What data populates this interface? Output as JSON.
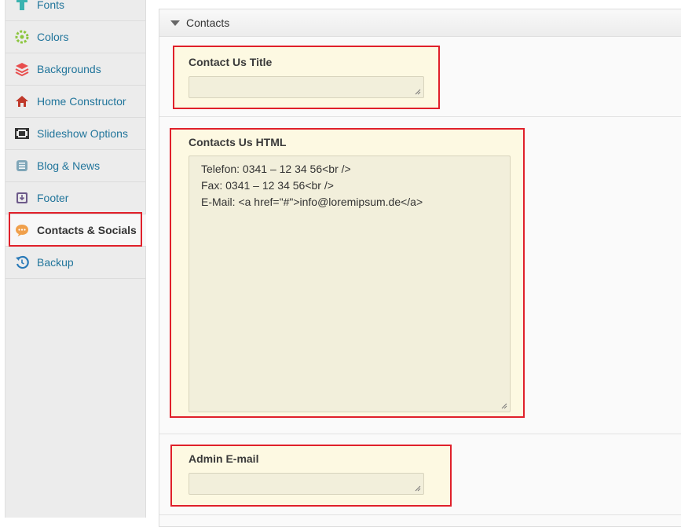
{
  "sidebar": {
    "items": [
      {
        "label": "Fonts",
        "icon": "fonts-icon",
        "color": "#3bb3b0"
      },
      {
        "label": "Colors",
        "icon": "colors-icon",
        "color": "#8cc63f"
      },
      {
        "label": "Backgrounds",
        "icon": "backgrounds-icon",
        "color": "#e84e4e"
      },
      {
        "label": "Home Constructor",
        "icon": "home-icon",
        "color": "#c0392b"
      },
      {
        "label": "Slideshow Options",
        "icon": "film-icon",
        "color": "#333333"
      },
      {
        "label": "Blog & News",
        "icon": "blog-icon",
        "color": "#7fa6b8"
      },
      {
        "label": "Footer",
        "icon": "footer-icon",
        "color": "#6d5a8a"
      },
      {
        "label": "Contacts & Socials",
        "icon": "chat-bubble-icon",
        "color": "#f0a04b",
        "active": true
      },
      {
        "label": "Backup",
        "icon": "backup-icon",
        "color": "#2a7ab8"
      }
    ]
  },
  "section": {
    "title": "Contacts"
  },
  "fields": {
    "contact_title": {
      "label": "Contact Us Title",
      "value": ""
    },
    "contacts_html": {
      "label": "Contacts Us HTML",
      "value": "Telefon: 0341 – 12 34 56<br />\nFax: 0341 – 12 34 56<br />\nE-Mail: <a href=\"#\">info@loremipsum.de</a>"
    },
    "admin_email": {
      "label": "Admin E-mail",
      "value": ""
    }
  },
  "colors": {
    "accent_link": "#21759b",
    "highlight_border": "#e0202a",
    "field_bg": "#fdf9e2"
  }
}
